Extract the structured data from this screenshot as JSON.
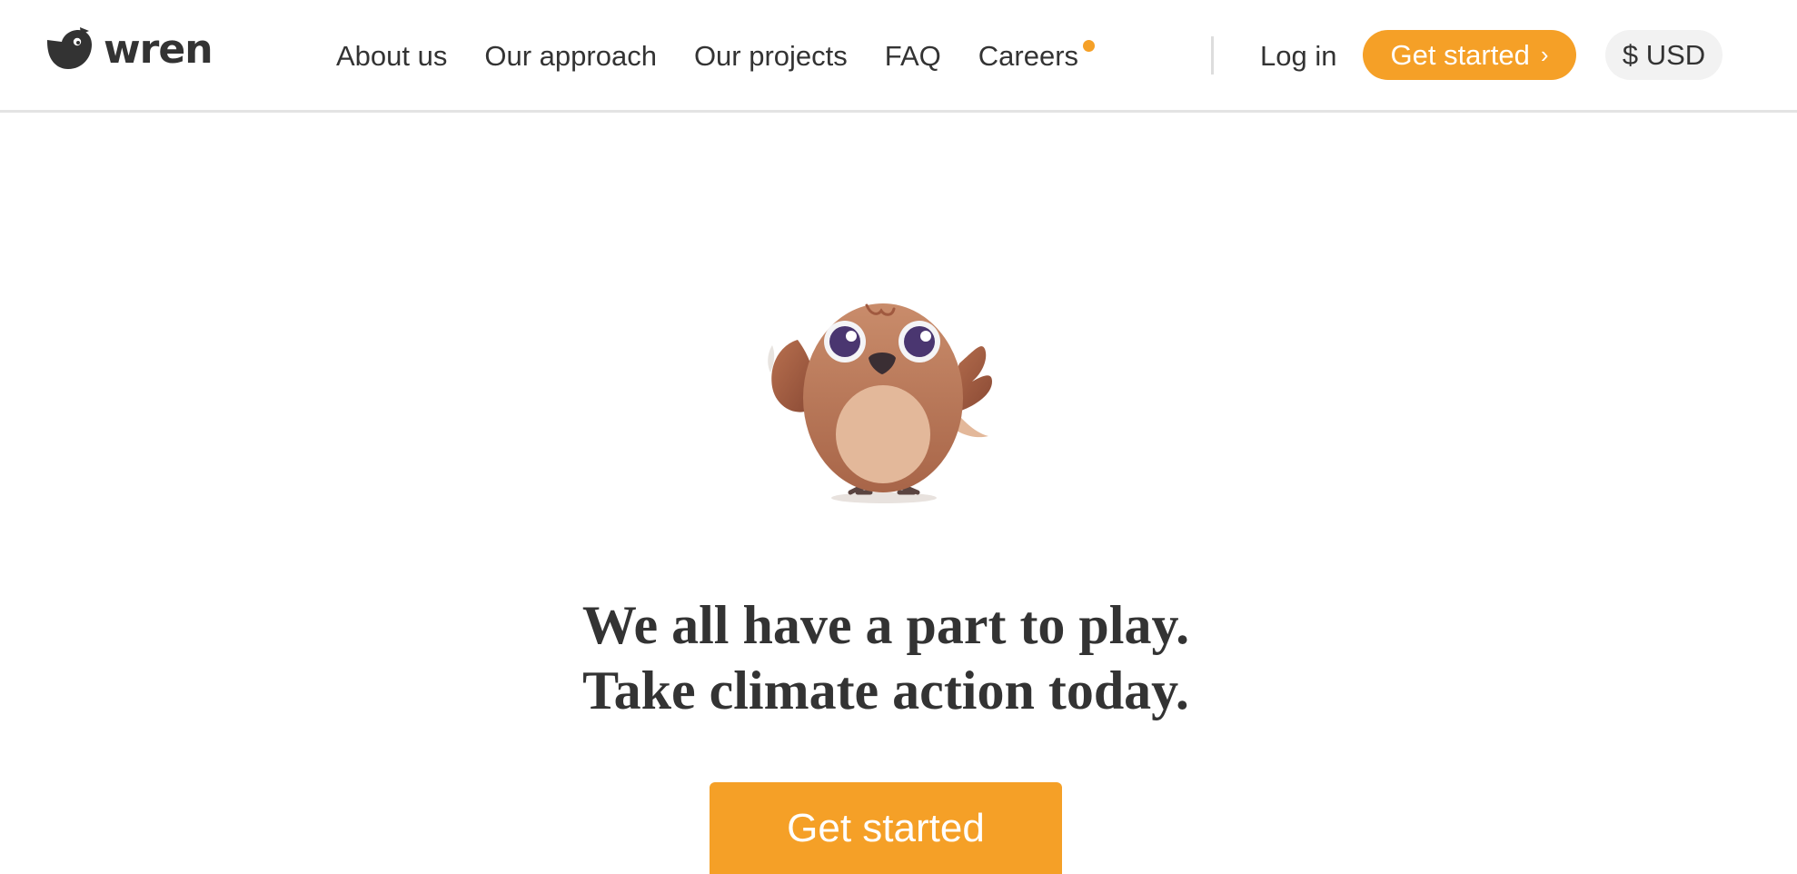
{
  "brand": {
    "name": "wren",
    "logo_icon": "bird-logo-icon"
  },
  "nav": {
    "items": [
      {
        "label": "About us"
      },
      {
        "label": "Our approach"
      },
      {
        "label": "Our projects"
      },
      {
        "label": "FAQ"
      },
      {
        "label": "Careers",
        "badge": "orange-dot"
      }
    ]
  },
  "actions": {
    "login_label": "Log in",
    "get_started_label": "Get started",
    "chevron": "›",
    "currency_label": "$ USD"
  },
  "hero": {
    "illustration": "bird-mascot-illustration",
    "headline_line1": "We all have a part to play.",
    "headline_line2": "Take climate action today.",
    "cta_label": "Get started"
  },
  "colors": {
    "accent": "#f5a027",
    "text": "#333333",
    "currency_bg": "#f2f2f2",
    "divider": "#dddddd"
  }
}
